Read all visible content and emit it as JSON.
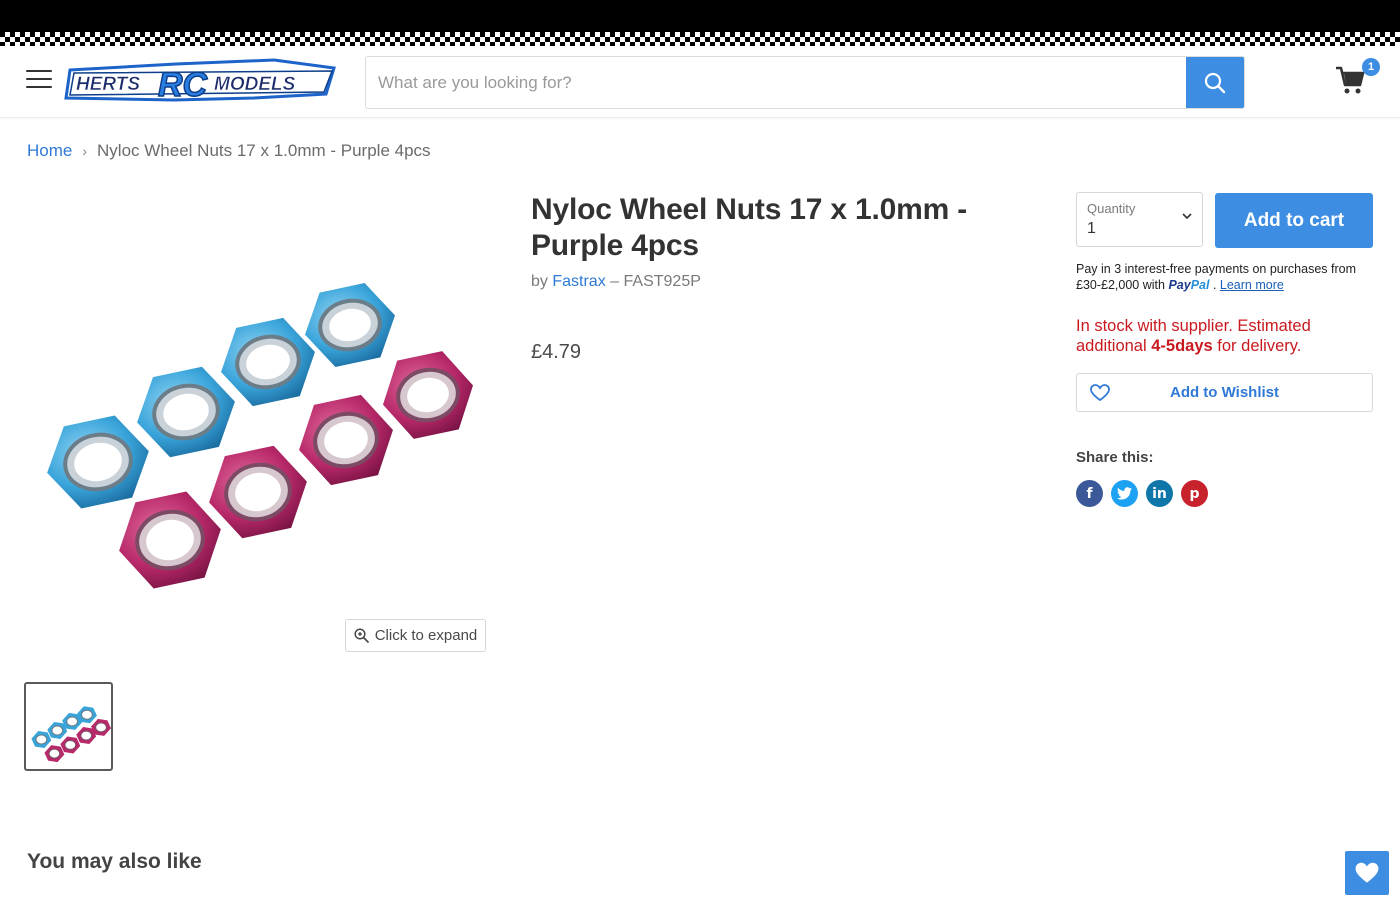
{
  "header": {
    "logo_text": "HERTS RC MODELS",
    "search_placeholder": "What are you looking for?",
    "cart_count": "1"
  },
  "breadcrumb": {
    "home": "Home",
    "separator": "›",
    "current": "Nyloc Wheel Nuts 17 x 1.0mm - Purple 4pcs"
  },
  "product": {
    "title": "Nyloc Wheel Nuts 17 x 1.0mm - Purple 4pcs",
    "by": "by",
    "vendor": "Fastrax",
    "sku_sep": "–",
    "sku": "FAST925P",
    "price": "£4.79",
    "expand_label": "Click to expand"
  },
  "buy_box": {
    "quantity_label": "Quantity",
    "quantity_value": "1",
    "add_to_cart": "Add to cart",
    "paypal_text_1": "Pay in 3 interest-free payments on purchases from £30-£2,000 with",
    "paypal_brand_1": "Pay",
    "paypal_brand_2": "Pal",
    "paypal_dot": ".",
    "paypal_learn": "Learn more",
    "stock_pre": "In stock with supplier. Estimated additional",
    "stock_days": "4-5days",
    "stock_post": "for delivery.",
    "wishlist_label": "Add to Wishlist",
    "share_title": "Share this:"
  },
  "share": {
    "facebook": "f",
    "twitter": "t",
    "linkedin": "in",
    "pinterest": "p"
  },
  "colors": {
    "accent": "#3d8de3",
    "stock_red": "#c8191f",
    "link": "#2f7ad6"
  },
  "sections": {
    "also_like": "You may also like"
  }
}
